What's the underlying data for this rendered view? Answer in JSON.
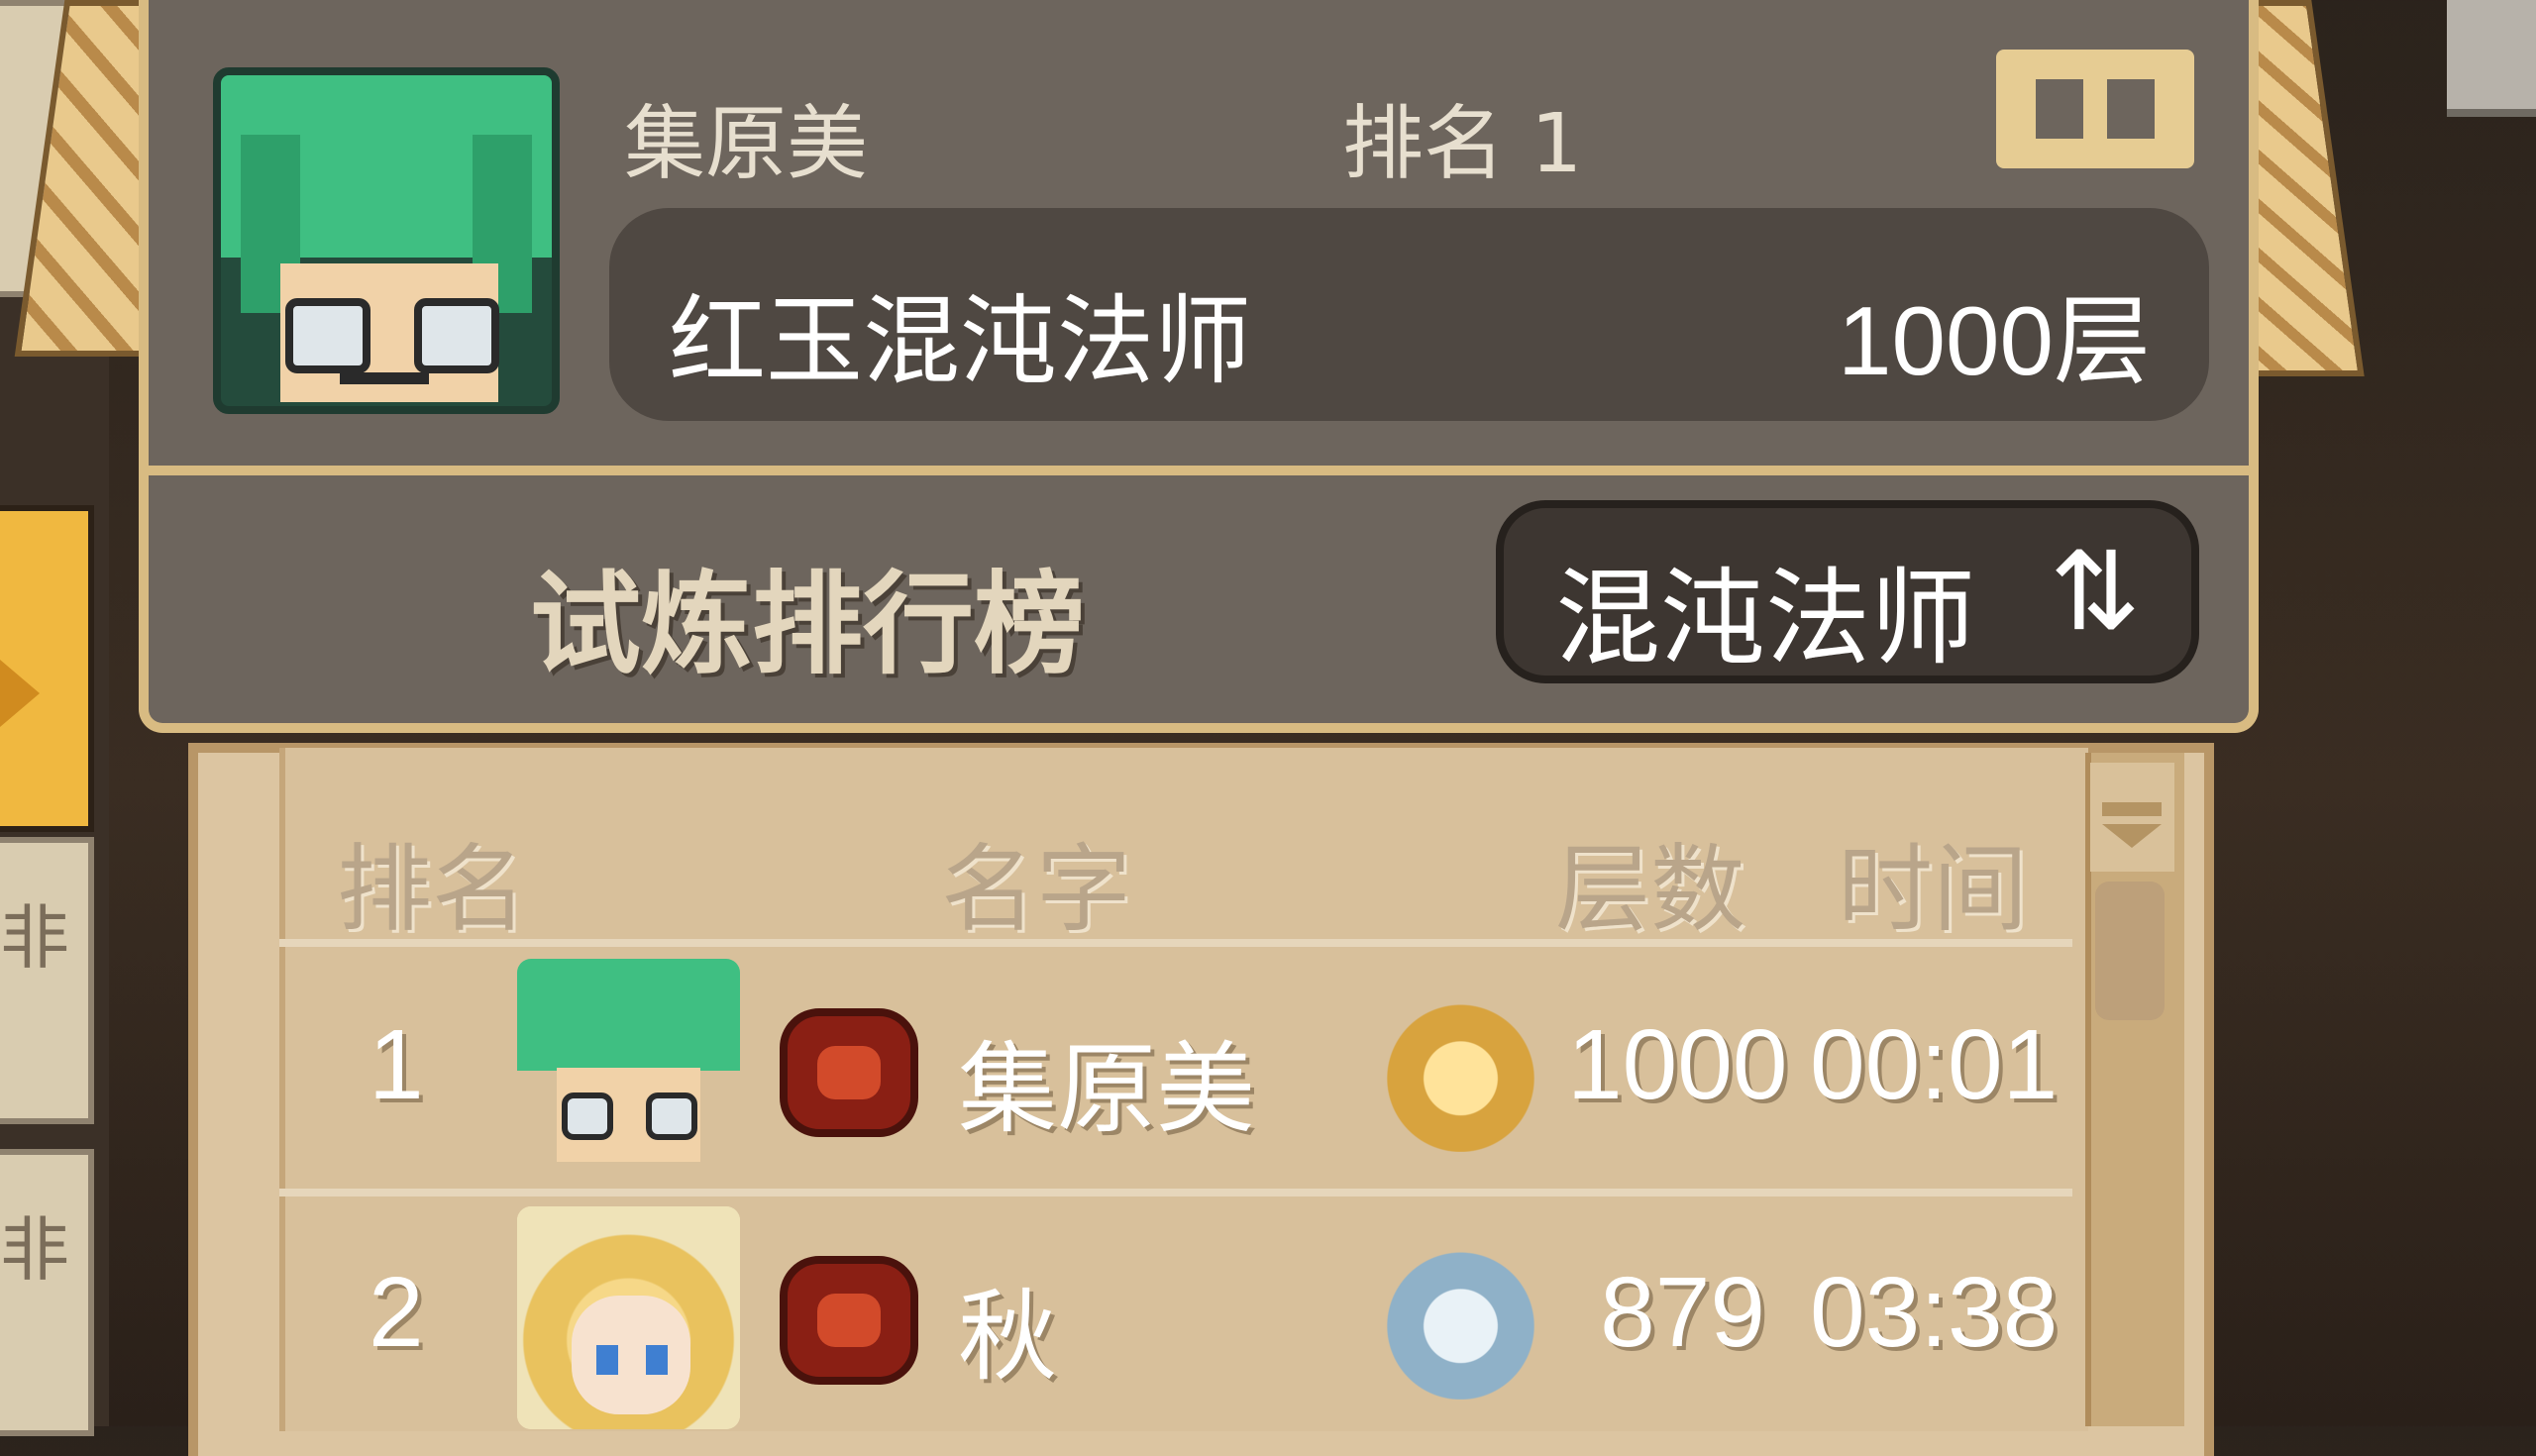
{
  "header": {
    "player_name": "集原美",
    "rank_label": "排名 1",
    "record": {
      "class_name": "红玉混沌法师",
      "floor": "1000层"
    }
  },
  "board": {
    "title": "试炼排行榜",
    "class_selector": "混沌法师",
    "switch_icon_glyph": "⇅"
  },
  "side_tabs": [
    "非",
    "非"
  ],
  "table": {
    "columns": {
      "rank": "排名",
      "name": "名字",
      "floor": "层数",
      "time": "时间"
    },
    "rows": [
      {
        "rank": "1",
        "name": "集原美",
        "floor": "1000",
        "time": "00:01",
        "trophy": "gold-trophy-icon",
        "avatar": "green-hair-glasses"
      },
      {
        "rank": "2",
        "name": "秋",
        "floor": "879",
        "time": "03:38",
        "trophy": "silver-trophy-icon",
        "avatar": "blonde-girl"
      }
    ]
  },
  "colors": {
    "panel": "#6d655d",
    "border_gold": "#d8bb82",
    "table_bg": "#d8c09b",
    "active_tab": "#f0b840"
  }
}
